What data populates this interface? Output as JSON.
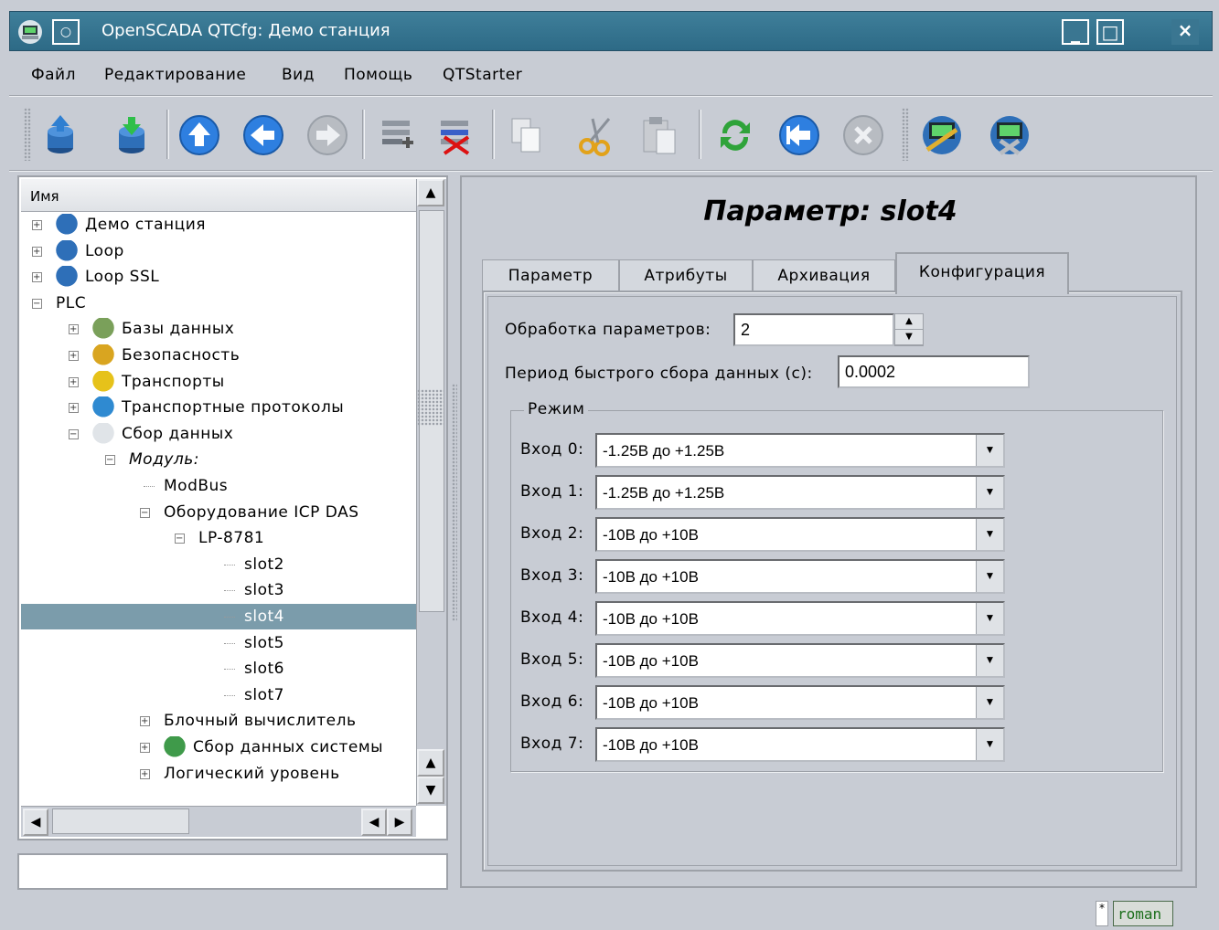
{
  "window": {
    "title": "OpenSCADA QTCfg: Демо станция",
    "minimize_label": "_",
    "maximize_label": "□",
    "close_label": "×"
  },
  "menu": [
    {
      "label": "Файл"
    },
    {
      "label": "Редактирование"
    },
    {
      "label": "Вид"
    },
    {
      "label": "Помощь"
    },
    {
      "label": "QTStarter"
    }
  ],
  "toolbar": {
    "icons": [
      "db-load-icon",
      "db-save-icon",
      "up-icon",
      "back-icon",
      "forward-icon",
      "add-item-icon",
      "delete-item-icon",
      "copy-icon",
      "cut-icon",
      "paste-icon",
      "refresh-icon",
      "start-icon",
      "stop-icon",
      "station-icon",
      "station-alt-icon"
    ]
  },
  "tree": {
    "header": "Имя",
    "items": [
      {
        "label": "Демо станция",
        "indent": 0,
        "expander": "+",
        "icon": "station-icon"
      },
      {
        "label": "Loop",
        "indent": 0,
        "expander": "+",
        "icon": "station-icon"
      },
      {
        "label": "Loop SSL",
        "indent": 0,
        "expander": "+",
        "icon": "station-icon"
      },
      {
        "label": "PLC",
        "indent": 0,
        "expander": "−",
        "icon": ""
      },
      {
        "label": "Базы данных",
        "indent": 1,
        "expander": "+",
        "icon": "database-icon"
      },
      {
        "label": "Безопасность",
        "indent": 1,
        "expander": "+",
        "icon": "security-icon"
      },
      {
        "label": "Транспорты",
        "indent": 1,
        "expander": "+",
        "icon": "transport-icon"
      },
      {
        "label": "Транспортные протоколы",
        "indent": 1,
        "expander": "+",
        "icon": "protocols-icon"
      },
      {
        "label": "Сбор данных",
        "indent": 1,
        "expander": "−",
        "icon": "daq-icon"
      },
      {
        "label": "Модуль:",
        "indent": 2,
        "expander": "−",
        "icon": ""
      },
      {
        "label": "ModBus",
        "indent": 3,
        "expander": "",
        "icon": ""
      },
      {
        "label": "Оборудование ICP DAS",
        "indent": 3,
        "expander": "−",
        "icon": ""
      },
      {
        "label": "LP-8781",
        "indent": 4,
        "expander": "−",
        "icon": ""
      },
      {
        "label": "slot2",
        "indent": 5,
        "expander": "",
        "icon": ""
      },
      {
        "label": "slot3",
        "indent": 5,
        "expander": "",
        "icon": ""
      },
      {
        "label": "slot4",
        "indent": 5,
        "expander": "",
        "icon": ""
      },
      {
        "label": "slot5",
        "indent": 5,
        "expander": "",
        "icon": ""
      },
      {
        "label": "slot6",
        "indent": 5,
        "expander": "",
        "icon": ""
      },
      {
        "label": "slot7",
        "indent": 5,
        "expander": "",
        "icon": ""
      },
      {
        "label": "Блочный вычислитель",
        "indent": 3,
        "expander": "+",
        "icon": ""
      },
      {
        "label": "Сбор данных системы",
        "indent": 3,
        "expander": "+",
        "icon": "system-daq-icon"
      },
      {
        "label": "Логический уровень",
        "indent": 3,
        "expander": "+",
        "icon": ""
      }
    ],
    "selected": "slot4"
  },
  "status_field": "",
  "main": {
    "title": "Параметр: slot4",
    "tabs": [
      {
        "label": "Параметр"
      },
      {
        "label": "Атрибуты"
      },
      {
        "label": "Архивация"
      },
      {
        "label": "Конфигурация"
      }
    ],
    "active_tab": "Конфигурация",
    "processing_label": "Обработка параметров:",
    "processing_value": "2",
    "fast_period_label": "Период быстрого сбора данных (с):",
    "fast_period_value": "0.0002",
    "mode_group": "Режим",
    "inputs": [
      {
        "label": "Вход 0:",
        "value": "-1.25В до +1.25В"
      },
      {
        "label": "Вход 1:",
        "value": "-1.25В до +1.25В"
      },
      {
        "label": "Вход 2:",
        "value": "-10В до +10В"
      },
      {
        "label": "Вход 3:",
        "value": "-10В до +10В"
      },
      {
        "label": "Вход 4:",
        "value": "-10В до +10В"
      },
      {
        "label": "Вход 5:",
        "value": "-10В до +10В"
      },
      {
        "label": "Вход 6:",
        "value": "-10В до +10В"
      },
      {
        "label": "Вход 7:",
        "value": "-10В до +10В"
      }
    ]
  },
  "statusbar": {
    "modified_mark": "*",
    "user": "roman"
  }
}
